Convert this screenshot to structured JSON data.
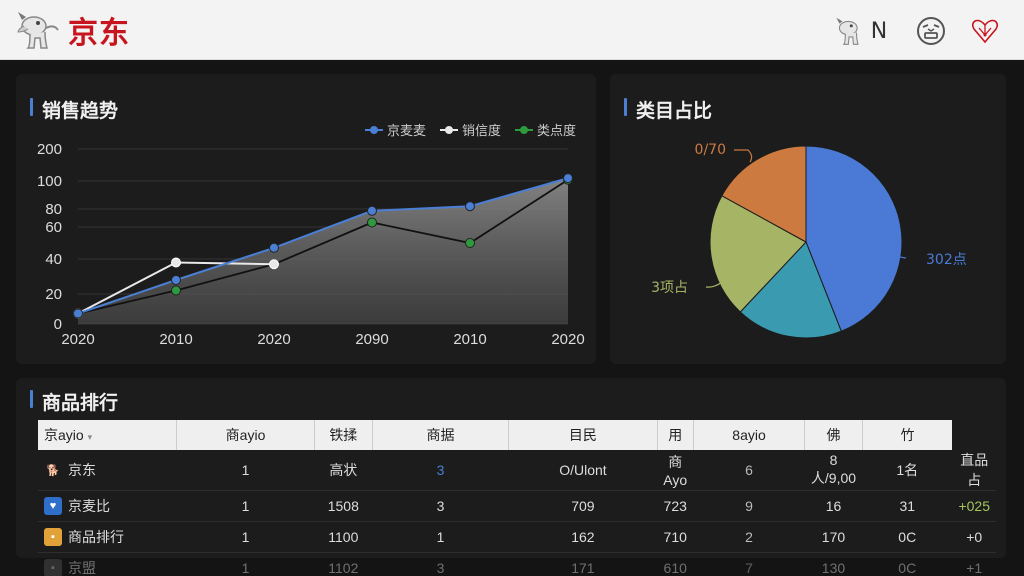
{
  "brand": {
    "name": "京东",
    "color": "#c8141e"
  },
  "top_icons": [
    "dog-mascot-icon",
    "robot-face-icon",
    "heart-network-icon"
  ],
  "top_icon_text": "N",
  "sales": {
    "title": "销售趋势",
    "legend": [
      "京麦麦",
      "销信度",
      "类点度"
    ]
  },
  "chart_data": [
    {
      "type": "line",
      "title": "销售趋势",
      "categories": [
        "2020",
        "2010",
        "2020",
        "2090",
        "2010",
        "2020"
      ],
      "y_ticks": [
        0,
        20,
        40,
        60,
        80,
        100,
        200
      ],
      "series": [
        {
          "name": "京麦麦",
          "color": "#4a7fd4",
          "values": [
            7,
            28,
            47,
            78,
            82,
            109
          ]
        },
        {
          "name": "销信度",
          "color": "#e8e8e8",
          "values": [
            7,
            38,
            37,
            null,
            null,
            null
          ]
        },
        {
          "name": "类点度",
          "color": "#2e9a3e",
          "values": [
            7,
            22,
            37,
            65,
            50,
            104
          ]
        }
      ]
    },
    {
      "type": "pie",
      "title": "类目占比",
      "labels": [
        "302点",
        "0/70",
        "3项占"
      ],
      "slices": [
        {
          "value": 44,
          "color": "#4a7ad6"
        },
        {
          "value": 18,
          "color": "#3a9ab0"
        },
        {
          "value": 21,
          "color": "#a6b466"
        },
        {
          "value": 17,
          "color": "#cc7a40"
        }
      ]
    }
  ],
  "category": {
    "title": "类目占比"
  },
  "ranking": {
    "title": "商品排行",
    "headers": [
      "京ayio",
      "商ayio",
      "铁揉",
      "商据",
      "目民",
      "用",
      "8ayio",
      "佛",
      "竹"
    ],
    "rows": [
      {
        "name": "京东",
        "icon": "dog-mascot-icon",
        "cells": [
          "1",
          "高状",
          "3",
          "O/Ulont",
          "商Ayo",
          "6",
          "8人/9,00",
          "1名",
          "直品占"
        ]
      },
      {
        "name": "京麦比",
        "icon": "blue-heart-icon",
        "cells": [
          "1",
          "1508",
          "3",
          "709",
          "723",
          "9",
          "16",
          "31",
          "+025"
        ]
      },
      {
        "name": "商品排行",
        "icon": "folder-icon",
        "cells": [
          "1",
          "1100",
          "1",
          "162",
          "710",
          "2",
          "170",
          "0C",
          "+0"
        ]
      },
      {
        "name": "京盟",
        "icon": "generic-icon",
        "cells": [
          "1",
          "1102",
          "3",
          "171",
          "610",
          "7",
          "130",
          "0C",
          "+1"
        ]
      }
    ]
  }
}
